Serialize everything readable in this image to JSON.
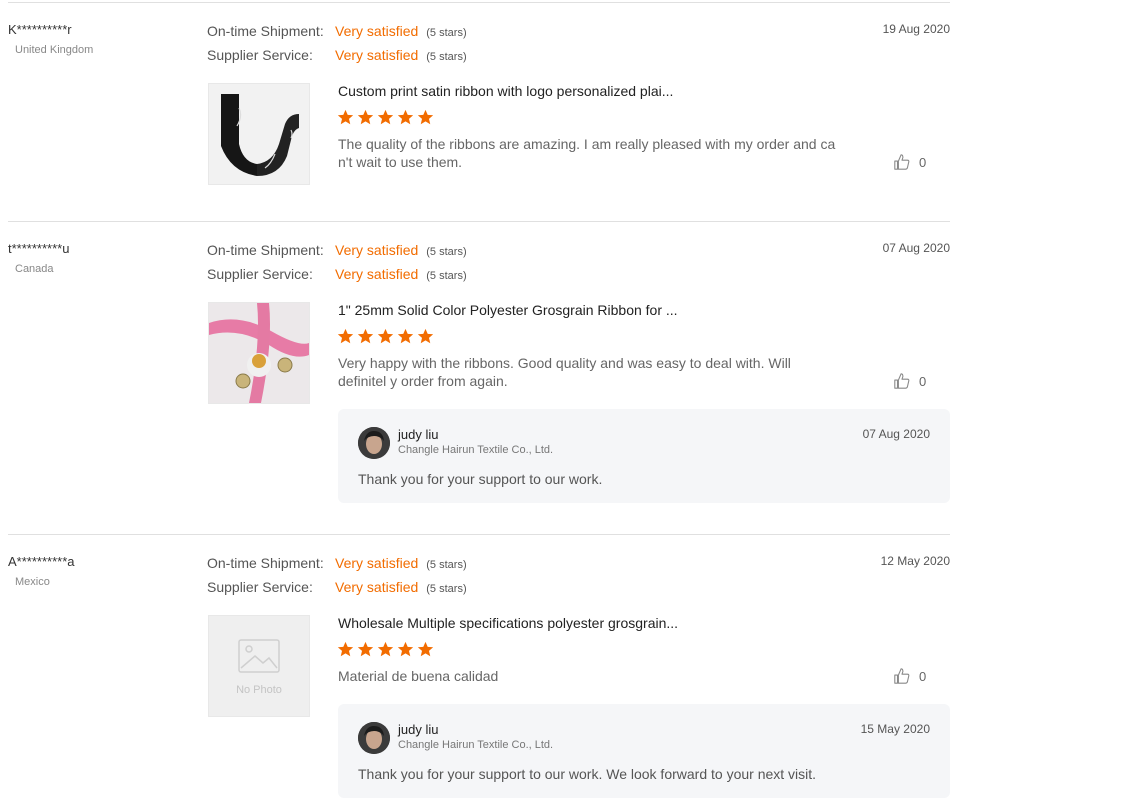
{
  "labels": {
    "on_time": "On-time Shipment:",
    "supplier": "Supplier Service:",
    "no_photo": "No Photo"
  },
  "colors": {
    "accent": "#f26c00",
    "separator": "#e0e0e0",
    "reply_bg": "#f5f6f8"
  },
  "reviews": [
    {
      "buyer": "K**********r",
      "country": "United Kingdom",
      "date": "19 Aug 2020",
      "on_time": "Very satisfied",
      "on_time_stars": "(5 stars)",
      "supplier": "Very satisfied",
      "supplier_stars": "(5 stars)",
      "product": "Custom print satin ribbon with logo personalized plai...",
      "rating": 5,
      "comment": "The quality of the ribbons are amazing. I am really pleased with my order and ca n't wait to use them.",
      "likes": "0"
    },
    {
      "buyer": "t**********u",
      "country": "Canada",
      "date": "07 Aug 2020",
      "on_time": "Very satisfied",
      "on_time_stars": "(5 stars)",
      "supplier": "Very satisfied",
      "supplier_stars": "(5 stars)",
      "product": "1\" 25mm Solid Color Polyester Grosgrain Ribbon for ...",
      "rating": 5,
      "comment": "Very happy with the ribbons. Good quality and was easy to deal with. Will definitel y order from again.",
      "likes": "0",
      "reply": {
        "name": "judy liu",
        "company": "Changle Hairun Textile Co., Ltd.",
        "date": "07 Aug 2020",
        "text": "Thank you for your support to our work."
      }
    },
    {
      "buyer": "A**********a",
      "country": "Mexico",
      "date": "12 May 2020",
      "on_time": "Very satisfied",
      "on_time_stars": "(5 stars)",
      "supplier": "Very satisfied",
      "supplier_stars": "(5 stars)",
      "product": "Wholesale Multiple specifications polyester grosgrain...",
      "rating": 5,
      "comment": "Material de buena calidad",
      "likes": "0",
      "reply": {
        "name": "judy liu",
        "company": "Changle Hairun Textile Co., Ltd.",
        "date": "15 May 2020",
        "text": "Thank you for your support to our work. We look forward to your next visit."
      }
    }
  ]
}
